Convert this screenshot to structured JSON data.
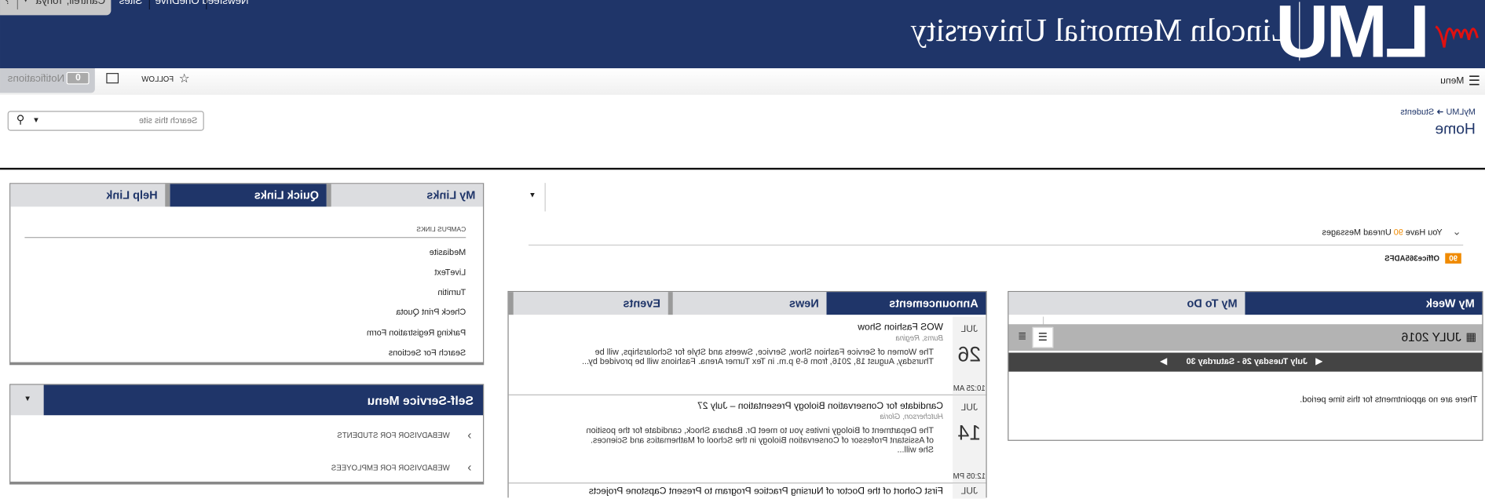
{
  "header": {
    "logo_text": "LMU",
    "university": "Lincoln Memorial University",
    "links": [
      "Newsfeed",
      "OneDrive",
      "Sites"
    ],
    "user": "Cantrell, Tonya",
    "brand_color": "#1f3569",
    "signature_color": "#e01010"
  },
  "subbar": {
    "menu": "Menu",
    "follow": "FOLLOW",
    "notifications_count": "0",
    "notifications": "Notifications"
  },
  "breadcrumb": {
    "parent": "MyLMU",
    "current": "Students",
    "title": "Home"
  },
  "search": {
    "placeholder": "Search this site"
  },
  "messages": {
    "prefix": "You Have ",
    "count": "90",
    "suffix": " Unread Messages",
    "badge": "90",
    "source": "Office365ADFS",
    "badge_color": "#f08a00"
  },
  "myweek": {
    "tabs": [
      "My Week",
      "My To Do"
    ],
    "month": "JULY 2016",
    "range": "July Tuesday 26 - Saturday 30",
    "empty": "There are no appointments for this time period."
  },
  "announcements": {
    "tabs": [
      "Announcements",
      "News",
      "Events"
    ],
    "items": [
      {
        "month": "JUL",
        "day": "26",
        "time": "10:25 AM",
        "title": "WOS Fashion Show",
        "author": "Bums, Regina",
        "body": "The Women of Service Fashion Show, Service, Sweets and Style for Scholarships, will be Thursday, August 18, 2016, from 6-9 p.m. in Tex Turner Arena.  Fashions will be provided by..."
      },
      {
        "month": "JUL",
        "day": "14",
        "time": "12:05 PM",
        "title": "Candidate for Conservation Biology Presentation – July 27",
        "author": "Hutcherson, Gloria",
        "body": "The Department of Biology invites you to meet Dr. Barbara Shock, candidate for the position of Assistant Professor of Conservation Biology in the School of Mathematics and Sciences. She will..."
      },
      {
        "month": "JUL",
        "title": "First Cohort of the Doctor of Nursing Practice Program to Present Capstone Projects"
      }
    ]
  },
  "links": {
    "tabs": [
      "My Links",
      "Quick Links",
      "Help Link"
    ],
    "heading": "CAMPUS LINKS",
    "items": [
      "Mediasite",
      "LiveText",
      "Turnitin",
      "Check Print Quota",
      "Parking Registration Form",
      "Search For Sections"
    ]
  },
  "selfservice": {
    "title": "Self-Service Menu",
    "items": [
      "WEBADVISOR FOR STUDENTS",
      "WEBADVISOR FOR EMPLOYEES"
    ]
  }
}
